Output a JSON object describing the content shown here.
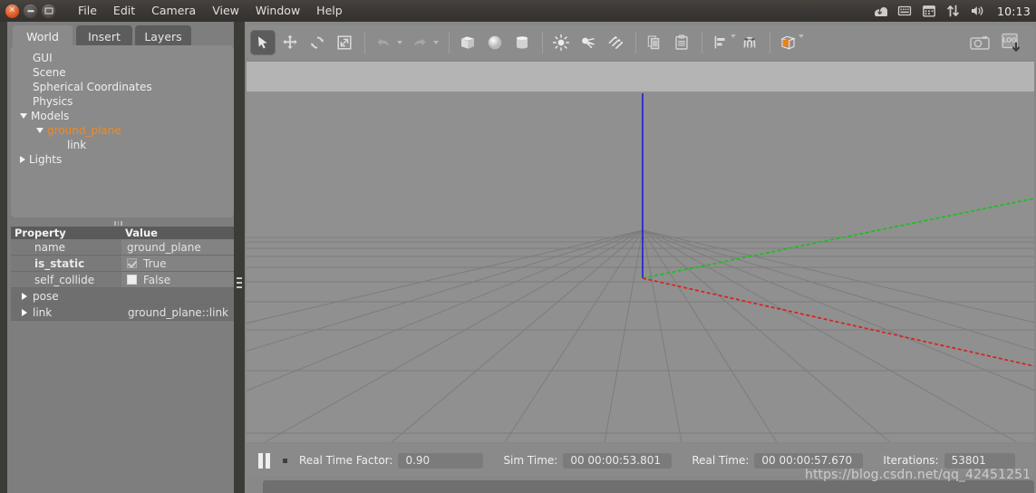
{
  "desktop": {
    "window_buttons": [
      "close",
      "minimize",
      "maximize"
    ],
    "menu": [
      "File",
      "Edit",
      "Camera",
      "View",
      "Window",
      "Help"
    ],
    "tray_icons": [
      "software-update-icon",
      "keyboard-input-icon",
      "calendar-icon",
      "network-icon",
      "volume-icon"
    ],
    "clock": "10:13"
  },
  "left_panel": {
    "tabs": [
      {
        "label": "World",
        "active": true
      },
      {
        "label": "Insert",
        "active": false
      },
      {
        "label": "Layers",
        "active": false
      }
    ],
    "tree": [
      {
        "label": "GUI",
        "indent": 1,
        "twisty": "none",
        "selected": false
      },
      {
        "label": "Scene",
        "indent": 1,
        "twisty": "none",
        "selected": false
      },
      {
        "label": "Spherical Coordinates",
        "indent": 1,
        "twisty": "none",
        "selected": false
      },
      {
        "label": "Physics",
        "indent": 1,
        "twisty": "none",
        "selected": false
      },
      {
        "label": "Models",
        "indent": 1,
        "twisty": "down",
        "selected": false
      },
      {
        "label": "ground_plane",
        "indent": 2,
        "twisty": "down",
        "selected": true
      },
      {
        "label": "link",
        "indent": 3,
        "twisty": "none",
        "selected": false
      },
      {
        "label": "Lights",
        "indent": 1,
        "twisty": "right",
        "selected": false
      }
    ],
    "property_table": {
      "headers": [
        "Property",
        "Value"
      ],
      "rows": [
        {
          "name": "name",
          "value": "ground_plane",
          "kind": "text",
          "bold": false
        },
        {
          "name": "is_static",
          "value": "True",
          "kind": "checkbox-on",
          "bold": true
        },
        {
          "name": "self_collide",
          "value": "False",
          "kind": "checkbox-off",
          "bold": false
        },
        {
          "name": "pose",
          "value": "",
          "kind": "group",
          "bold": false
        },
        {
          "name": "link",
          "value": "ground_plane::link",
          "kind": "group",
          "bold": false
        }
      ]
    }
  },
  "toolbar": {
    "buttons": [
      {
        "name": "select-mode",
        "icon": "cursor-arrow-icon",
        "active": true
      },
      {
        "name": "translate-mode",
        "icon": "move-arrows-icon",
        "active": false
      },
      {
        "name": "rotate-mode",
        "icon": "rotate-icon",
        "active": false
      },
      {
        "name": "scale-mode",
        "icon": "scale-icon",
        "active": false
      },
      {
        "name": "undo",
        "icon": "undo-arrow-icon",
        "active": false
      },
      {
        "name": "redo",
        "icon": "redo-arrow-icon",
        "active": false
      },
      {
        "name": "insert-box",
        "icon": "box-icon",
        "active": false
      },
      {
        "name": "insert-sphere",
        "icon": "sphere-icon",
        "active": false
      },
      {
        "name": "insert-cylinder",
        "icon": "cylinder-icon",
        "active": false
      },
      {
        "name": "insert-point-light",
        "icon": "point-light-icon",
        "active": false
      },
      {
        "name": "insert-spot-light",
        "icon": "spot-light-icon",
        "active": false
      },
      {
        "name": "insert-directional-light",
        "icon": "directional-light-icon",
        "active": false
      },
      {
        "name": "copy",
        "icon": "copy-icon",
        "active": false
      },
      {
        "name": "paste",
        "icon": "paste-icon",
        "active": false
      },
      {
        "name": "align",
        "icon": "align-icon",
        "active": false
      },
      {
        "name": "snap",
        "icon": "magnet-snap-icon",
        "active": false
      },
      {
        "name": "view-appearance",
        "icon": "orange-cube-icon",
        "active": false
      },
      {
        "name": "screenshot",
        "icon": "camera-icon",
        "active": false
      },
      {
        "name": "log-recorder",
        "icon": "log-download-icon",
        "active": false
      }
    ],
    "log_label": "LOG"
  },
  "viewport": {
    "sky_color": "#b4b4b4",
    "ground_color": "#909090",
    "grid_color": "#7c7c7c",
    "axes": [
      {
        "name": "x-axis",
        "color": "#dd1f1f"
      },
      {
        "name": "y-axis",
        "color": "#16c216"
      },
      {
        "name": "z-axis",
        "color": "#2222dd"
      }
    ]
  },
  "status_bar": {
    "play_state": "paused",
    "fields": [
      {
        "label": "Real Time Factor:",
        "value": "0.90"
      },
      {
        "label": "Sim Time:",
        "value": "00 00:00:53.801"
      },
      {
        "label": "Real Time:",
        "value": "00 00:00:57.670"
      },
      {
        "label": "Iterations:",
        "value": "53801"
      }
    ]
  },
  "watermark": "https://blog.csdn.net/qq_42451251"
}
